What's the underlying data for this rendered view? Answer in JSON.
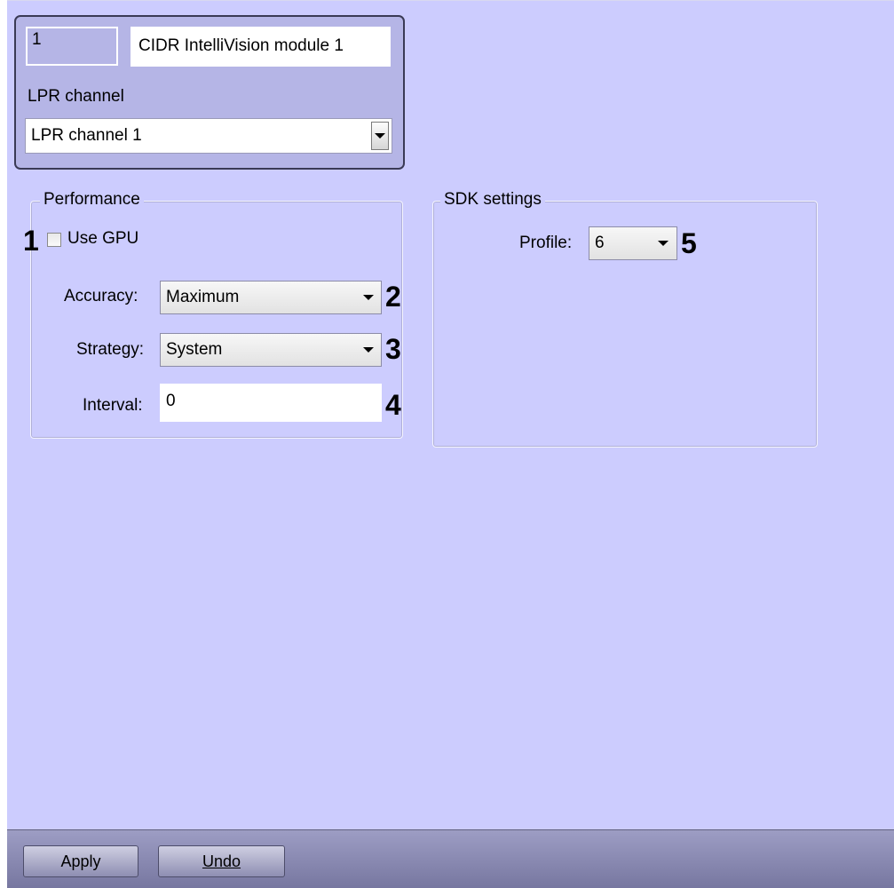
{
  "header": {
    "id_value": "1",
    "name_value": "CIDR IntelliVision module 1",
    "channel_label": "LPR channel",
    "channel_value": "LPR channel 1"
  },
  "performance": {
    "title": "Performance",
    "use_gpu_label": "Use GPU",
    "use_gpu_checked": false,
    "accuracy_label": "Accuracy:",
    "accuracy_value": "Maximum",
    "strategy_label": "Strategy:",
    "strategy_value": "System",
    "interval_label": "Interval:",
    "interval_value": "0"
  },
  "sdk": {
    "title": "SDK settings",
    "profile_label": "Profile:",
    "profile_value": "6"
  },
  "callouts": [
    "1",
    "2",
    "3",
    "4",
    "5"
  ],
  "footer": {
    "apply_label": "Apply",
    "undo_label": "Undo"
  },
  "colors": {
    "panel_bg": "#ccccfe",
    "header_bg": "#b5b5e6",
    "footer_bg": "#8a8ab2"
  },
  "icons": {
    "dropdown": "chevron-down-icon"
  }
}
